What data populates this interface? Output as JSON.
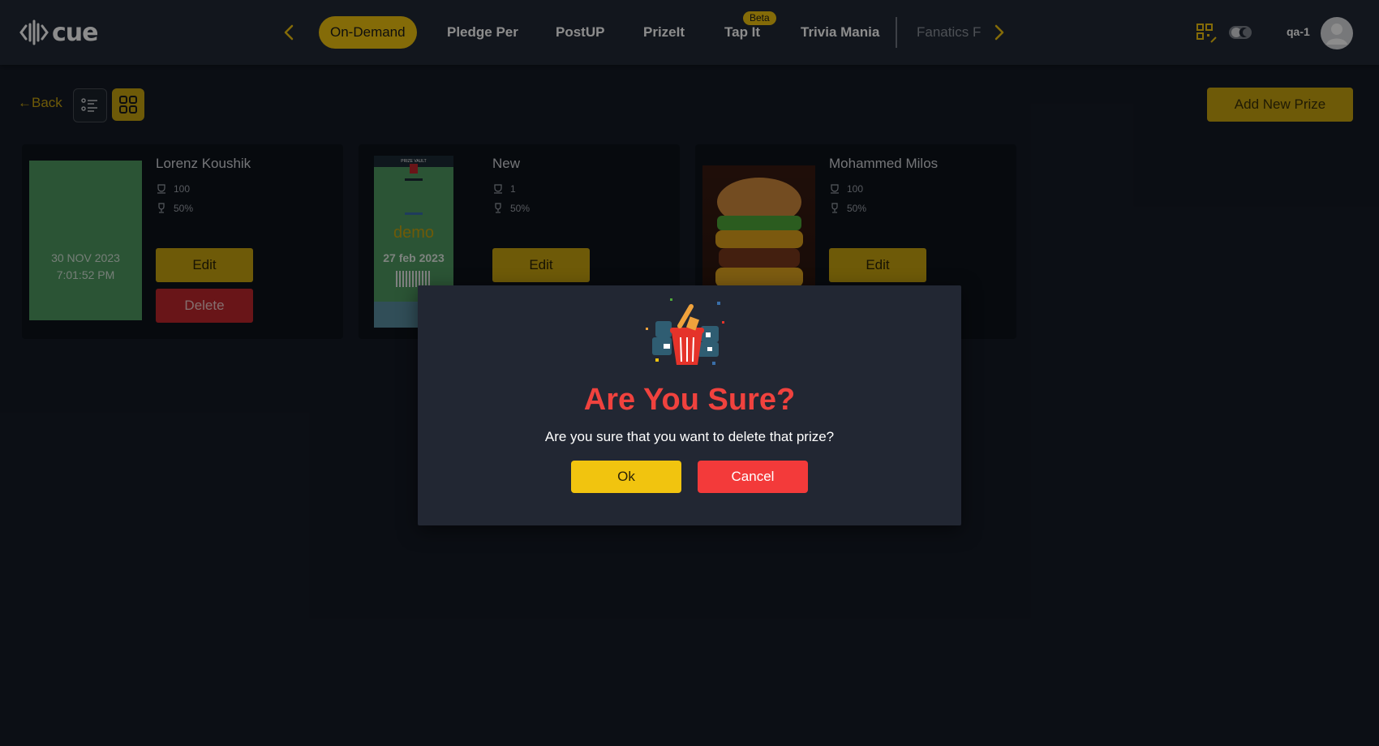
{
  "header": {
    "logo_text": "cue",
    "nav_items": [
      "On-Demand",
      "Pledge Per",
      "PostUP",
      "PrizeIt",
      "Tap It",
      "Trivia Mania",
      "Fanatics F"
    ],
    "beta_badge": "Beta",
    "user_name": "qa-1",
    "icons": {
      "prev": "chevron-left-icon",
      "next": "chevron-right-icon",
      "qr": "qr-code-icon",
      "theme": "theme-toggle-icon",
      "avatar": "user-avatar-icon"
    }
  },
  "toolbar": {
    "back_label": "←Back",
    "add_label": "Add New Prize",
    "icons": {
      "list": "list-view-icon",
      "grid": "grid-view-icon"
    }
  },
  "cards": [
    {
      "name": "Lorenz Koushik",
      "stat1": "100",
      "stat2": "50%",
      "image_date": "30 NOV 2023",
      "image_time": "7:01:52 PM",
      "edit_label": "Edit",
      "delete_label": "Delete"
    },
    {
      "name": "New",
      "stat1": "1",
      "stat2": "50%",
      "image_top": "PRIZE VAULT",
      "image_word": "demo",
      "image_date": "27 feb 2023",
      "edit_label": "Edit"
    },
    {
      "name": "Mohammed Milos",
      "stat1": "100",
      "stat2": "50%",
      "edit_label": "Edit"
    }
  ],
  "modal": {
    "title": "Are You Sure?",
    "message": "Are you sure that you want to delete that prize?",
    "ok_label": "Ok",
    "cancel_label": "Cancel",
    "icon": "trash-bin-icon"
  },
  "colors": {
    "accent": "#f1c40f",
    "danger": "#f33a3a",
    "background": "#151b26",
    "header": "#222936"
  }
}
